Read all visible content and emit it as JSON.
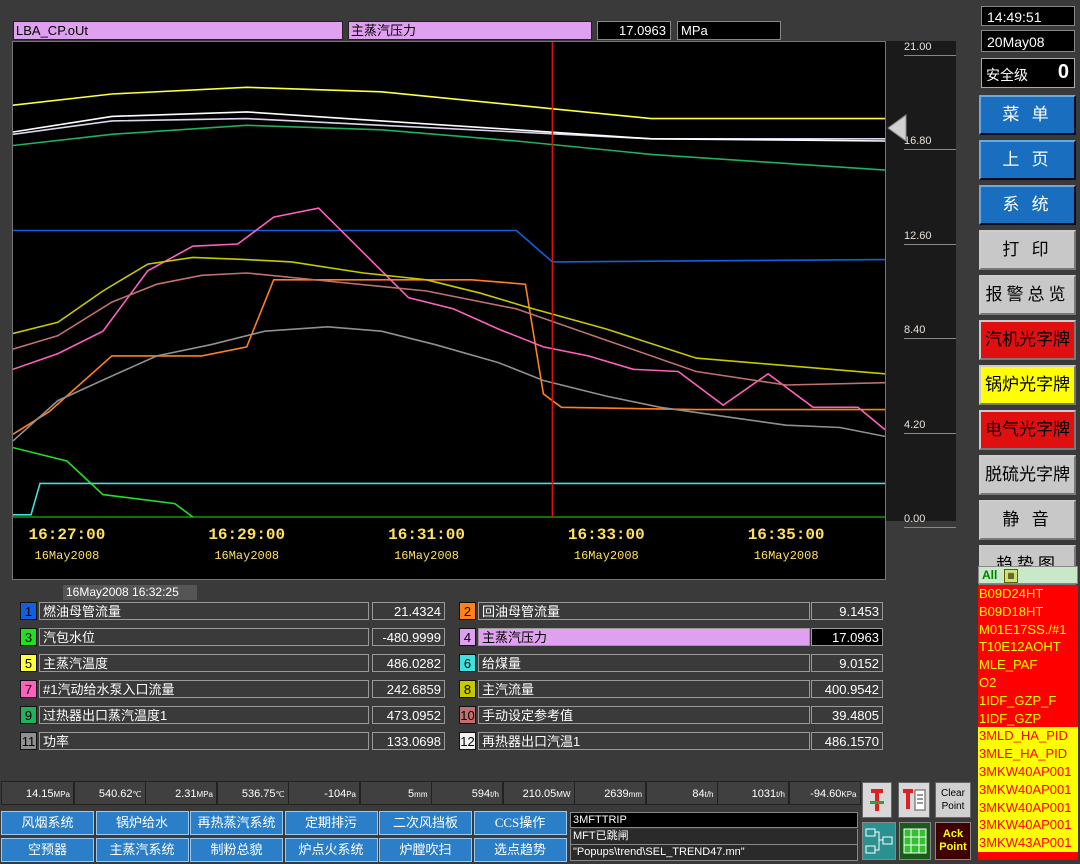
{
  "header": {
    "tag": "LBA_CP.oUt",
    "name": "主蒸汽压力",
    "value": "17.0963",
    "unit": "MPa"
  },
  "clock": {
    "time": "14:49:51",
    "date": "20May08"
  },
  "security": {
    "label": "安全级",
    "level": "0"
  },
  "right_buttons": [
    {
      "label": "菜 单",
      "style": "blue"
    },
    {
      "label": "上 页",
      "style": "blue"
    },
    {
      "label": "系 统",
      "style": "blue"
    },
    {
      "label": "打 印",
      "style": "gray"
    },
    {
      "label": "报警总览",
      "style": "gray"
    },
    {
      "label": "汽机光字牌",
      "style": "red"
    },
    {
      "label": "锅炉光字牌",
      "style": "yellow"
    },
    {
      "label": "电气光字牌",
      "style": "red"
    },
    {
      "label": "脱硫光字牌",
      "style": "graymid"
    },
    {
      "label": "静 音",
      "style": "gray"
    },
    {
      "label": "趋势图",
      "style": "gray"
    }
  ],
  "alarm_filter": {
    "all": "All",
    "icon": "filter-icon"
  },
  "alarms": [
    {
      "text": "B09D24HT",
      "color": "#ffff00"
    },
    {
      "text": "B09D18HT",
      "color": "#ffff00"
    },
    {
      "text": "M01E17SS./#1",
      "color": "#ffff00"
    },
    {
      "text": "T10E12AOHT",
      "color": "#ffff00"
    },
    {
      "text": "MLE_PAF",
      "color": "#ffff00"
    },
    {
      "text": "O2",
      "color": "#ffff00"
    },
    {
      "text": "1IDF_GZP_F",
      "color": "#ffff00"
    },
    {
      "text": "1IDF_GZP",
      "color": "#ffff00"
    },
    {
      "text": "3MLD_HA_PID",
      "color": "#ff0000"
    },
    {
      "text": "3MLE_HA_PID",
      "color": "#ff0000"
    },
    {
      "text": "3MKW40AP001",
      "color": "#ff0000"
    },
    {
      "text": "3MKW40AP001",
      "color": "#ff0000"
    },
    {
      "text": "3MKW40AP001",
      "color": "#ff0000"
    },
    {
      "text": "3MKW40AP001",
      "color": "#ff0000"
    },
    {
      "text": "3MKW43AP001",
      "color": "#ff0000"
    }
  ],
  "cursor_timestamp": "16May2008  16:32:25",
  "chart_data": {
    "type": "line",
    "ylim": [
      0,
      21
    ],
    "y_ticks": [
      "21.00",
      "16.80",
      "12.60",
      "8.40",
      "4.20",
      "0.00"
    ],
    "x_ticks": [
      {
        "time": "16:27:00",
        "date": "16May2008"
      },
      {
        "time": "16:29:00",
        "date": "16May2008"
      },
      {
        "time": "16:31:00",
        "date": "16May2008"
      },
      {
        "time": "16:33:00",
        "date": "16May2008"
      },
      {
        "time": "16:35:00",
        "date": "16May2008"
      }
    ],
    "x_range_minutes": [
      16.4,
      26.1
    ],
    "cursor_minute": 32.4,
    "cursor_color": "#e01010",
    "series": [
      {
        "id": 1,
        "color": "#1060e0",
        "x": [
          26.4,
          32.0,
          32.4,
          36.1
        ],
        "y": [
          12.8,
          12.8,
          11.4,
          11.5
        ]
      },
      {
        "id": 2,
        "color": "#ff8020",
        "x": [
          26.4,
          26.8,
          27.5,
          28.5,
          29.0,
          29.3,
          31.5,
          32.1,
          32.3,
          32.5,
          34.0,
          36.1
        ],
        "y": [
          3.7,
          4.7,
          7.2,
          7.2,
          7.6,
          10.6,
          10.6,
          10.4,
          5.5,
          4.9,
          4.8,
          4.8
        ]
      },
      {
        "id": 3,
        "color": "#20e020",
        "x": [
          26.4,
          27.0,
          27.4,
          27.8,
          28.2,
          28.4
        ],
        "y": [
          3.1,
          2.5,
          1.0,
          0.8,
          0.6,
          0.0
        ]
      },
      {
        "id": 4,
        "color": "#d8d8f0",
        "x": [
          26.4,
          27.5,
          29.0,
          30.5,
          32.0,
          33.5,
          36.1
        ],
        "y": [
          17.1,
          17.7,
          17.8,
          17.5,
          17.2,
          16.9,
          16.9
        ]
      },
      {
        "id": 5,
        "color": "#ffff40",
        "x": [
          26.4,
          27.5,
          29.0,
          30.5,
          32.0,
          33.5,
          36.1
        ],
        "y": [
          18.4,
          18.9,
          19.2,
          19.0,
          18.4,
          17.8,
          17.8
        ]
      },
      {
        "id": 6,
        "color": "#40e0e0",
        "x": [
          26.4,
          26.6,
          26.7,
          36.1
        ],
        "y": [
          0.1,
          0.1,
          1.5,
          1.5
        ]
      },
      {
        "id": 7,
        "color": "#ff60c0",
        "x": [
          26.4,
          26.9,
          27.4,
          27.9,
          28.4,
          28.9,
          29.3,
          29.8,
          30.3,
          30.8,
          31.3,
          31.8,
          32.3,
          32.8,
          33.3,
          33.8,
          34.3,
          34.8,
          35.3,
          35.8,
          36.1
        ],
        "y": [
          6.6,
          7.3,
          8.3,
          11.0,
          12.1,
          12.2,
          13.4,
          13.8,
          11.8,
          9.8,
          9.3,
          8.4,
          7.6,
          7.2,
          6.6,
          6.5,
          5.0,
          6.4,
          4.9,
          4.9,
          3.9
        ]
      },
      {
        "id": 8,
        "color": "#c8c800",
        "x": [
          26.4,
          26.9,
          27.4,
          27.9,
          28.4,
          29.0,
          29.5,
          30.3,
          31.0,
          31.6,
          32.1,
          33.0,
          34.0,
          35.5,
          36.1
        ],
        "y": [
          8.2,
          8.7,
          10.1,
          11.3,
          11.6,
          11.5,
          11.4,
          10.9,
          10.6,
          10.0,
          9.4,
          8.4,
          7.1,
          6.6,
          6.4
        ]
      },
      {
        "id": 9,
        "color": "#20b060",
        "x": [
          26.4,
          27.5,
          29.0,
          30.5,
          32.0,
          33.5,
          36.1
        ],
        "y": [
          16.6,
          17.1,
          17.5,
          17.3,
          16.8,
          16.2,
          15.5
        ]
      },
      {
        "id": 10,
        "color": "#c07070",
        "x": [
          26.4,
          26.9,
          27.5,
          28.0,
          28.5,
          29.0,
          30.0,
          31.0,
          32.0,
          33.0,
          34.0,
          35.0,
          36.1
        ],
        "y": [
          7.5,
          8.1,
          9.6,
          10.4,
          10.8,
          10.9,
          10.5,
          10.1,
          9.3,
          7.9,
          6.5,
          5.9,
          6.0
        ]
      },
      {
        "id": 11,
        "color": "#909090",
        "x": [
          26.4,
          26.9,
          27.5,
          28.0,
          28.6,
          29.2,
          29.9,
          30.5,
          31.1,
          31.8,
          32.3,
          33.0,
          33.6,
          34.3,
          35.0,
          35.6,
          36.1
        ],
        "y": [
          3.4,
          5.2,
          6.3,
          7.2,
          7.7,
          8.3,
          8.5,
          8.3,
          7.7,
          6.9,
          6.1,
          5.4,
          4.9,
          4.5,
          4.1,
          4.0,
          3.6
        ]
      },
      {
        "id": 12,
        "color": "#ffffff",
        "x": [
          26.4,
          27.5,
          29.0,
          30.5,
          32.0,
          33.5,
          36.1
        ],
        "y": [
          17.2,
          17.9,
          18.1,
          17.7,
          17.3,
          16.9,
          16.8
        ]
      }
    ]
  },
  "legend": [
    {
      "num": "1",
      "color": "#1060e0",
      "name": "燃油母管流量",
      "value": "21.4324"
    },
    {
      "num": "2",
      "color": "#ff8020",
      "name": "回油母管流量",
      "value": "9.1453"
    },
    {
      "num": "3",
      "color": "#20e020",
      "name": "汽包水位",
      "value": "-480.9999"
    },
    {
      "num": "4",
      "color": "#e0a0f0",
      "name": "主蒸汽压力",
      "value": "17.0963"
    },
    {
      "num": "5",
      "color": "#ffff40",
      "name": "主蒸汽温度",
      "value": "486.0282"
    },
    {
      "num": "6",
      "color": "#40e0e0",
      "name": "给煤量",
      "value": "9.0152"
    },
    {
      "num": "7",
      "color": "#ff60c0",
      "name": "#1汽动给水泵入口流量",
      "value": "242.6859"
    },
    {
      "num": "8",
      "color": "#c8c800",
      "name": "主汽流量",
      "value": "400.9542"
    },
    {
      "num": "9",
      "color": "#20b060",
      "name": "过热器出口蒸汽温度1",
      "value": "473.0952"
    },
    {
      "num": "10",
      "color": "#c07070",
      "name": "手动设定参考值",
      "value": "39.4805"
    },
    {
      "num": "11",
      "color": "#909090",
      "name": "功率",
      "value": "133.0698"
    },
    {
      "num": "12",
      "color": "#f0f0f0",
      "name": "再热器出口汽温1",
      "value": "486.1570"
    }
  ],
  "status_bar": [
    {
      "v": "14.15",
      "u": "MPa"
    },
    {
      "v": "540.62",
      "u": "℃"
    },
    {
      "v": "2.31",
      "u": "MPa"
    },
    {
      "v": "536.75",
      "u": "℃"
    },
    {
      "v": "-104",
      "u": "Pa"
    },
    {
      "v": "5",
      "u": "mm"
    },
    {
      "v": "594",
      "u": "t/h"
    },
    {
      "v": "210.05",
      "u": "MW"
    },
    {
      "v": "2639",
      "u": "mm"
    },
    {
      "v": "84",
      "u": "t/h"
    },
    {
      "v": "1031",
      "u": "t/h"
    },
    {
      "v": "-94.60",
      "u": "KPa"
    }
  ],
  "nav_row1": [
    "风烟系统",
    "锅炉给水",
    "再热蒸汽系统",
    "定期排污",
    "二次风挡板",
    "CCS操作"
  ],
  "nav_row2": [
    "空预器",
    "主蒸汽系统",
    "制粉总貌",
    "炉点火系统",
    "炉膛吹扫",
    "选点趋势"
  ],
  "message": {
    "line1": "3MFTTRIP",
    "line2": "MFT已跳闸",
    "line3": "\"Popups\\trend\\SEL_TREND47.mn\""
  },
  "tools": {
    "clear_point": "Clear Point",
    "ack_point": "Ack Point"
  }
}
